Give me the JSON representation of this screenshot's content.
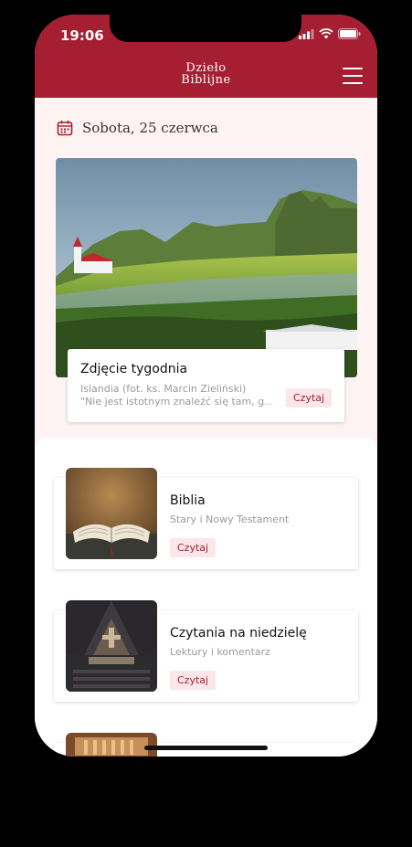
{
  "status_bar": {
    "time": "19:06"
  },
  "header": {
    "logo_line1": "Dzieło",
    "logo_line2": "Biblijne",
    "colors": {
      "brand": "#a61e32",
      "brand_light": "#fbe7ea"
    }
  },
  "date": {
    "label": "Sobota, 25 czerwca",
    "icon": "calendar-icon"
  },
  "photo_of_week": {
    "title": "Zdjęcie tygodnia",
    "subtitle": "Islandia (fot. ks. Marcin Zieliński)",
    "quote": "\"Nie jest istotnym znaleźć się tam, g...",
    "button": "Czytaj"
  },
  "items": [
    {
      "title": "Biblia",
      "subtitle": "Stary i Nowy Testament",
      "button": "Czytaj"
    },
    {
      "title": "Czytania na niedzielę",
      "subtitle": "Lektury i komentarz",
      "button": "Czytaj"
    }
  ]
}
